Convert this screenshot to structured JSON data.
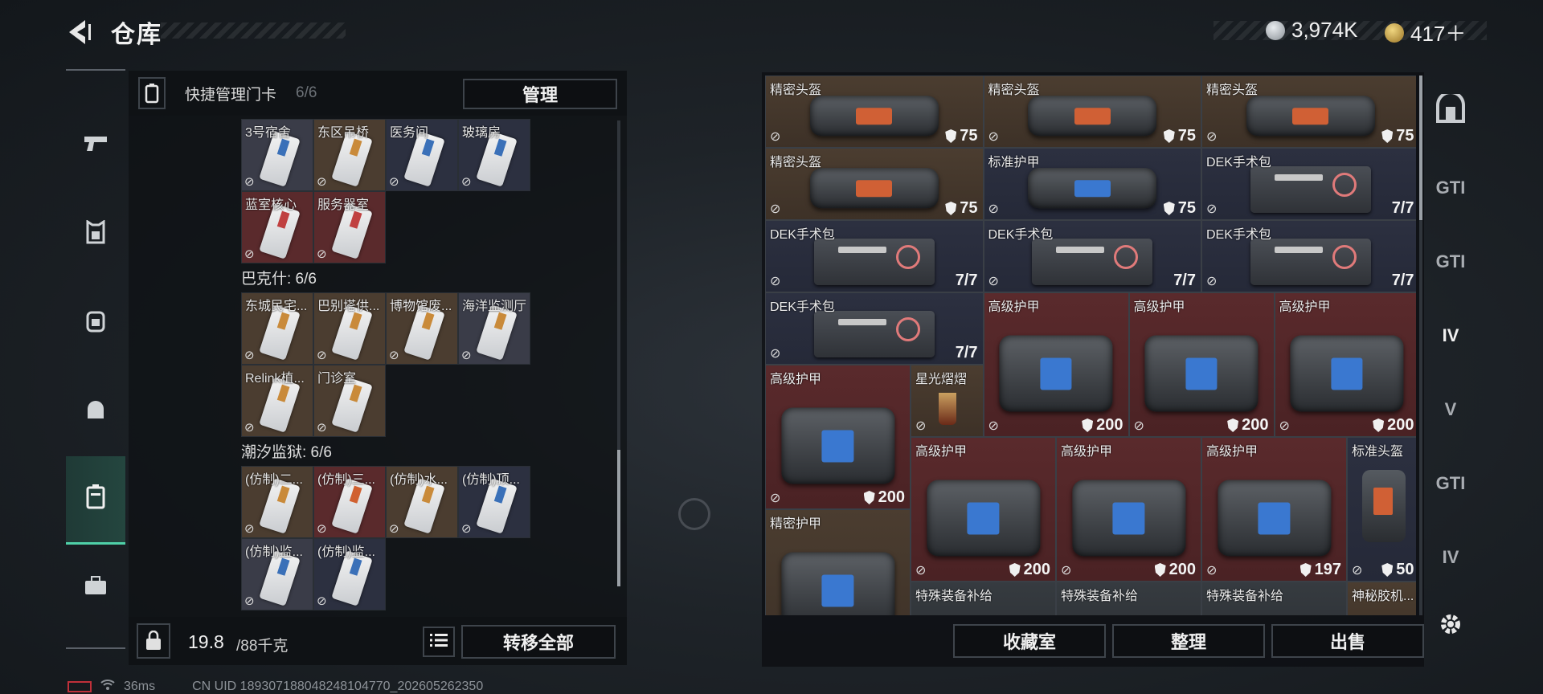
{
  "header": {
    "title": "仓库"
  },
  "currency": {
    "coins": "3,974K",
    "premium": "417＋",
    "coin_color": "#b9bec4",
    "premium_color": "#c8a24a"
  },
  "left_nav": [
    {
      "icon": "pistol-icon"
    },
    {
      "icon": "armor-vest-icon"
    },
    {
      "icon": "backpack-icon"
    },
    {
      "icon": "helmet-bag-icon"
    },
    {
      "icon": "keycard-case-icon",
      "active": true
    },
    {
      "icon": "toolbox-icon"
    }
  ],
  "left_panel": {
    "header_label": "快捷管理门卡",
    "hidden_count": "6/6",
    "manage_button": "管理",
    "group_1": {
      "cards": [
        {
          "name": "3号宿舍",
          "stripe": "#3a70b8",
          "bg": "#3a3c48"
        },
        {
          "name": "东区吊桥",
          "stripe": "#c98a3a",
          "bg": "#4b3d30"
        },
        {
          "name": "医务间",
          "stripe": "#3a70b8",
          "bg": "#2c3040"
        },
        {
          "name": "玻璃房",
          "stripe": "#3a70b8",
          "bg": "#2c3040"
        },
        {
          "name": "蓝室核心",
          "stripe": "#c04040",
          "bg": "#5a2a2c"
        },
        {
          "name": "服务器室",
          "stripe": "#c04040",
          "bg": "#5a2a2c"
        }
      ]
    },
    "group_2": {
      "title": "巴克什: 6/6",
      "cards": [
        {
          "name": "东城民宅...",
          "stripe": "#c98a3a",
          "bg": "#4b3d30"
        },
        {
          "name": "巴别塔供...",
          "stripe": "#c98a3a",
          "bg": "#4b3d30"
        },
        {
          "name": "博物馆废...",
          "stripe": "#c98a3a",
          "bg": "#4b3d30"
        },
        {
          "name": "海洋监测厅",
          "stripe": "#c98a3a",
          "bg": "#3a3c48"
        },
        {
          "name": "Relink植...",
          "stripe": "#c98a3a",
          "bg": "#4b3d30"
        },
        {
          "name": "门诊室",
          "stripe": "#c98a3a",
          "bg": "#4b3d30"
        }
      ]
    },
    "group_3": {
      "title": "潮汐监狱: 6/6",
      "cards": [
        {
          "name": "(仿制)二...",
          "stripe": "#c98a3a",
          "bg": "#4b3d30"
        },
        {
          "name": "(仿制)三...",
          "stripe": "#d06030",
          "bg": "#5a2a2c"
        },
        {
          "name": "(仿制)水...",
          "stripe": "#c98a3a",
          "bg": "#4b3d30"
        },
        {
          "name": "(仿制)顶...",
          "stripe": "#3a70b8",
          "bg": "#2c3040"
        },
        {
          "name": "(仿制)监...",
          "stripe": "#3a70b8",
          "bg": "#3a3c48"
        },
        {
          "name": "(仿制)监...",
          "stripe": "#3a70b8",
          "bg": "#2c3040"
        }
      ]
    },
    "weight": "19.8",
    "weight_max": "/88千克",
    "transfer_all_button": "转移全部"
  },
  "stash": {
    "items": [
      {
        "name": "精密头盔",
        "value": "75",
        "shield": true
      },
      {
        "name": "精密头盔",
        "value": "75",
        "shield": true
      },
      {
        "name": "精密头盔",
        "value": "75",
        "shield": true
      },
      {
        "name": "精密头盔",
        "value": "75",
        "shield": true
      },
      {
        "name": "标准护甲",
        "value": "75",
        "shield": true
      },
      {
        "name": "DEK手术包",
        "value": "7/7",
        "shield": false
      },
      {
        "name": "DEK手术包",
        "value": "7/7",
        "shield": false
      },
      {
        "name": "DEK手术包",
        "value": "7/7",
        "shield": false
      },
      {
        "name": "DEK手术包",
        "value": "7/7",
        "shield": false
      },
      {
        "name": "DEK手术包",
        "value": "7/7",
        "shield": false
      },
      {
        "name": "高级护甲",
        "value": "200",
        "shield": true
      },
      {
        "name": "高级护甲",
        "value": "200",
        "shield": true
      },
      {
        "name": "高级护甲",
        "value": "200",
        "shield": true
      },
      {
        "name": "高级护甲",
        "value": "200",
        "shield": true
      },
      {
        "name": "星光熠熠",
        "value": "",
        "shield": false
      },
      {
        "name": "高级护甲",
        "value": "200",
        "shield": true
      },
      {
        "name": "高级护甲",
        "value": "200",
        "shield": true
      },
      {
        "name": "高级护甲",
        "value": "197",
        "shield": true
      },
      {
        "name": "标准头盔",
        "value": "50",
        "shield": true
      },
      {
        "name": "精密护甲",
        "value": "",
        "shield": false
      },
      {
        "name": "特殊装备补给",
        "value": "",
        "shield": false
      },
      {
        "name": "特殊装备补给",
        "value": "",
        "shield": false
      },
      {
        "name": "特殊装备补给",
        "value": "",
        "shield": false
      },
      {
        "name": "神秘胶机...",
        "value": "",
        "shield": false
      }
    ],
    "buttons": {
      "collection": "收藏室",
      "sort": "整理",
      "sell": "出售"
    }
  },
  "right_nav": [
    "GTI",
    "GTI",
    "IV",
    "V",
    "GTI",
    "IV"
  ],
  "status": {
    "ping": "36ms",
    "uid": "CN UID 18930718804824810477​0_202605262350"
  }
}
